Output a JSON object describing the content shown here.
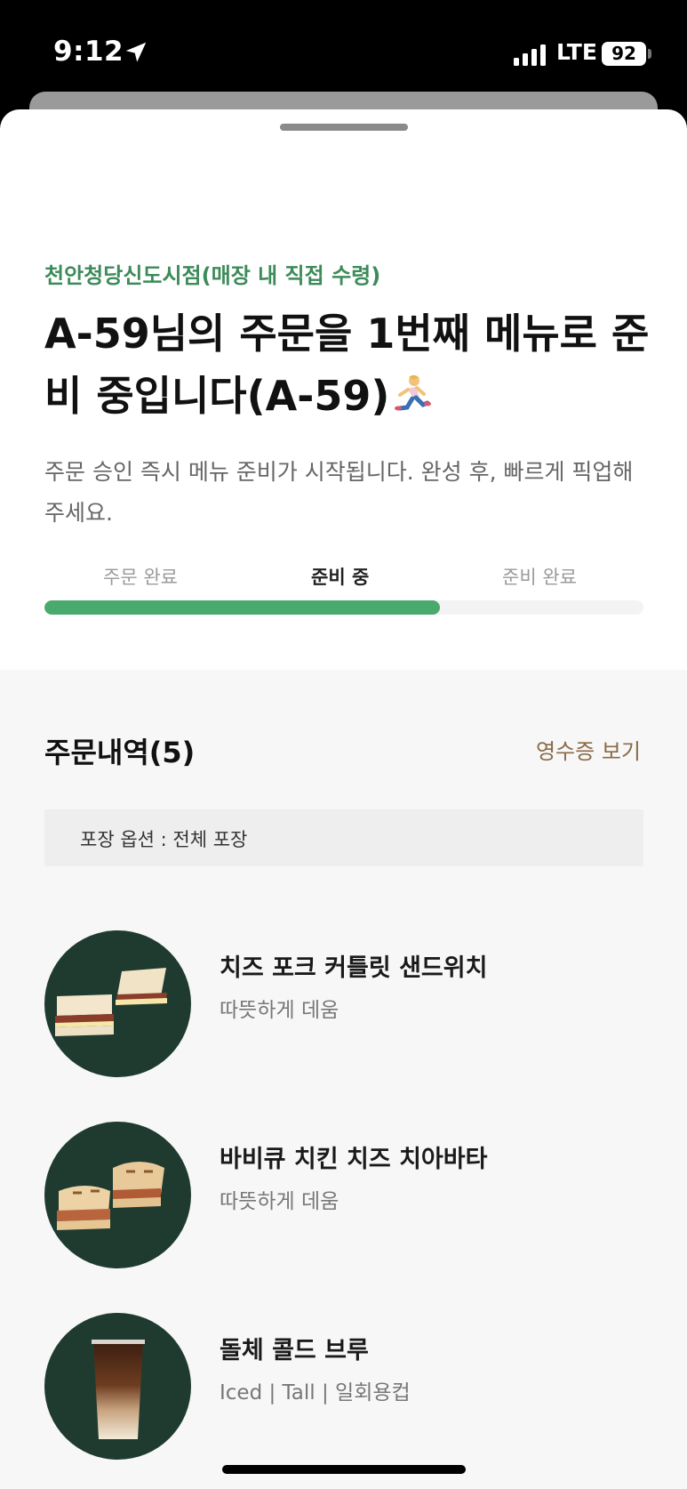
{
  "status_bar": {
    "time": "9:12",
    "network": "LTE",
    "battery": "92"
  },
  "order": {
    "store": "천안청당신도시점(매장 내 직접 수령)",
    "headline": "A-59님의 주문을 1번째 메뉴로 준비 중입니다(A-59)",
    "headline_emoji": "runner-icon",
    "subtext": "주문 승인 즉시 메뉴 준비가 시작됩니다. 완성 후, 빠르게 픽업해 주세요.",
    "steps": [
      "주문 완료",
      "준비 중",
      "준비 완료"
    ],
    "active_step": "준비 중",
    "progress": 0.66
  },
  "history": {
    "title": "주문내역(5)",
    "receipt_label": "영수증 보기",
    "packaging": "포장 옵션 : 전체 포장",
    "items": [
      {
        "name": "치즈 포크 커틀릿 샌드위치",
        "option": "따뜻하게 데움",
        "image": "sandwich-image"
      },
      {
        "name": "바비큐 치킨 치즈 치아바타",
        "option": "따뜻하게 데움",
        "image": "ciabatta-image"
      },
      {
        "name": "돌체 콜드 브루",
        "option": "Iced | Tall | 일회용컵",
        "image": "cold-brew-image"
      }
    ]
  },
  "colors": {
    "accent_green": "#4aaa6e",
    "store_green": "#3d8b5a",
    "receipt_brown": "#8a6a48",
    "item_bg": "#1f3b30"
  }
}
